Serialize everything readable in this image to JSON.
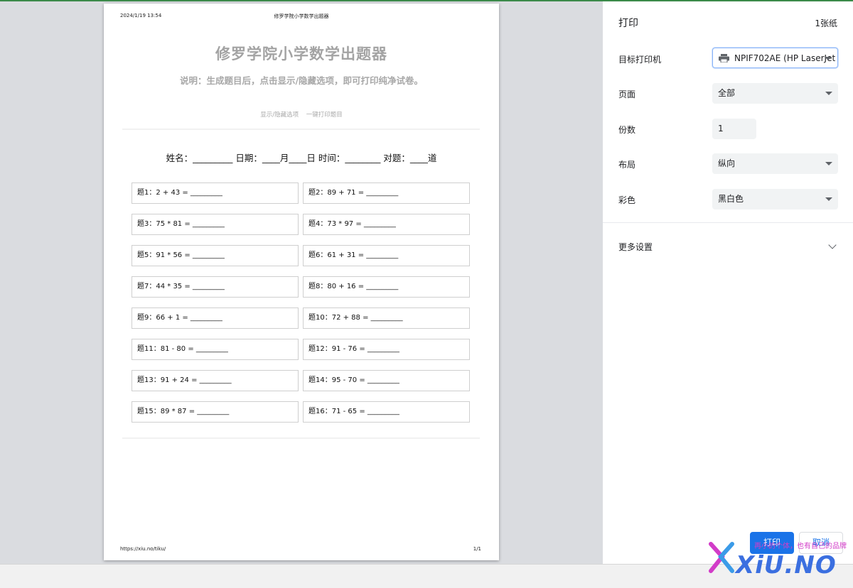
{
  "document": {
    "header_date": "2024/1/19 13:54",
    "header_title": "修罗学院小学数学出题器",
    "main_title": "修罗学院小学数学出题器",
    "instruction": "说明：生成题目后，点击显示/隐藏选项，即可打印纯净试卷。",
    "link_toggle": "显示/隐藏选项",
    "link_print": "一键打印题目",
    "info_line": "姓名：_________ 日期：____月____日 时间：________ 对题：____道",
    "questions": [
      "题1：2 + 43 = _________",
      "题2：89 + 71 = _________",
      "题3：75 * 81 = _________",
      "题4：73 * 97 = _________",
      "题5：91 * 56 = _________",
      "题6：61 + 31 = _________",
      "题7：44 * 35 = _________",
      "题8：80 + 16 = _________",
      "题9：66 + 1 = _________",
      "题10：72 + 88 = _________",
      "题11：81 - 80 = _________",
      "题12：91 - 76 = _________",
      "题13：91 + 24 = _________",
      "题14：95 - 70 = _________",
      "题15：89 * 87 = _________",
      "题16：71 - 65 = _________"
    ],
    "footer_url": "https://xiu.no/tiku/",
    "footer_page": "1/1"
  },
  "print_panel": {
    "title": "打印",
    "sheets": "1张纸",
    "destination_label": "目标打印机",
    "destination_value": "NPIF702AE (HP LaserJet",
    "pages_label": "页面",
    "pages_value": "全部",
    "copies_label": "份数",
    "copies_value": "1",
    "layout_label": "布局",
    "layout_value": "纵向",
    "color_label": "彩色",
    "color_value": "黑白色",
    "more_settings": "更多设置",
    "print_button": "打印",
    "cancel_button": "取消"
  },
  "watermark": {
    "slogan": "再小的个体，也有自己的品牌",
    "text": "XiU.NO"
  },
  "colors": {
    "accent": "#1a73e8",
    "preview_bg": "#dadce0",
    "title_gray": "#a3a3a3"
  }
}
